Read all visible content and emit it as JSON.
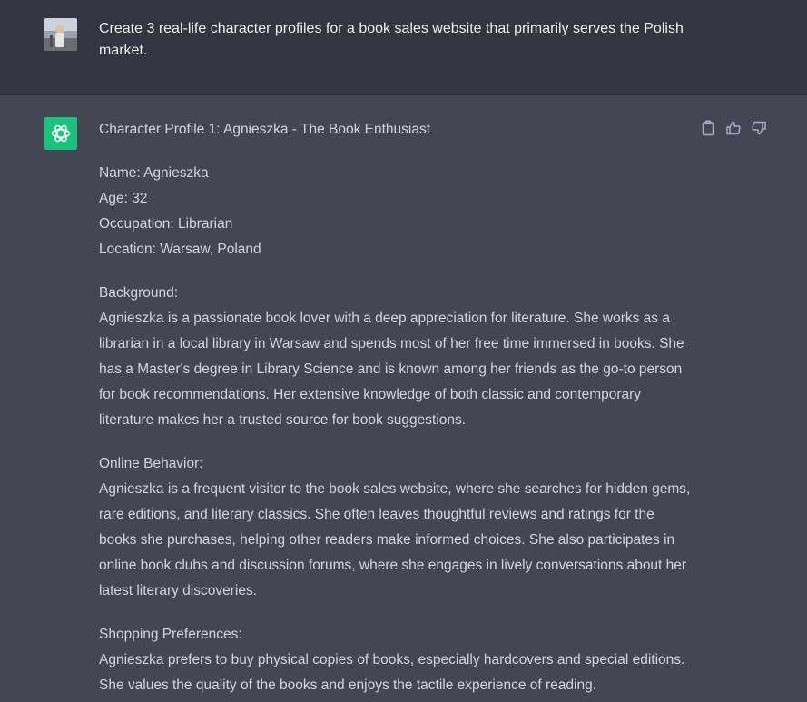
{
  "user_message": {
    "text": "Create 3 real-life character profiles for a book sales website that primarily serves the Polish market."
  },
  "assistant_message": {
    "heading": "Character Profile 1: Agnieszka - The Book Enthusiast",
    "details": [
      "Name: Agnieszka",
      "Age: 32",
      "Occupation: Librarian",
      "Location: Warsaw, Poland"
    ],
    "sections": [
      {
        "title": "Background:",
        "body": "Agnieszka is a passionate book lover with a deep appreciation for literature. She works as a librarian in a local library in Warsaw and spends most of her free time immersed in books. She has a Master's degree in Library Science and is known among her friends as the go-to person for book recommendations. Her extensive knowledge of both classic and contemporary literature makes her a trusted source for book suggestions."
      },
      {
        "title": "Online Behavior:",
        "body": "Agnieszka is a frequent visitor to the book sales website, where she searches for hidden gems, rare editions, and literary classics. She often leaves thoughtful reviews and ratings for the books she purchases, helping other readers make informed choices. She also participates in online book clubs and discussion forums, where she engages in lively conversations about her latest literary discoveries."
      },
      {
        "title": "Shopping Preferences:",
        "body": "Agnieszka prefers to buy physical copies of books, especially hardcovers and special editions. She values the quality of the books and enjoys the tactile experience of reading."
      }
    ]
  },
  "icons": {
    "copy": "clipboard-icon",
    "like": "thumbs-up-icon",
    "dislike": "thumbs-down-icon",
    "bot": "openai-logo-icon"
  },
  "colors": {
    "user_bg": "#343541",
    "assistant_bg": "#444654",
    "bot_avatar": "#19c37d",
    "text": "#d1d5db"
  }
}
